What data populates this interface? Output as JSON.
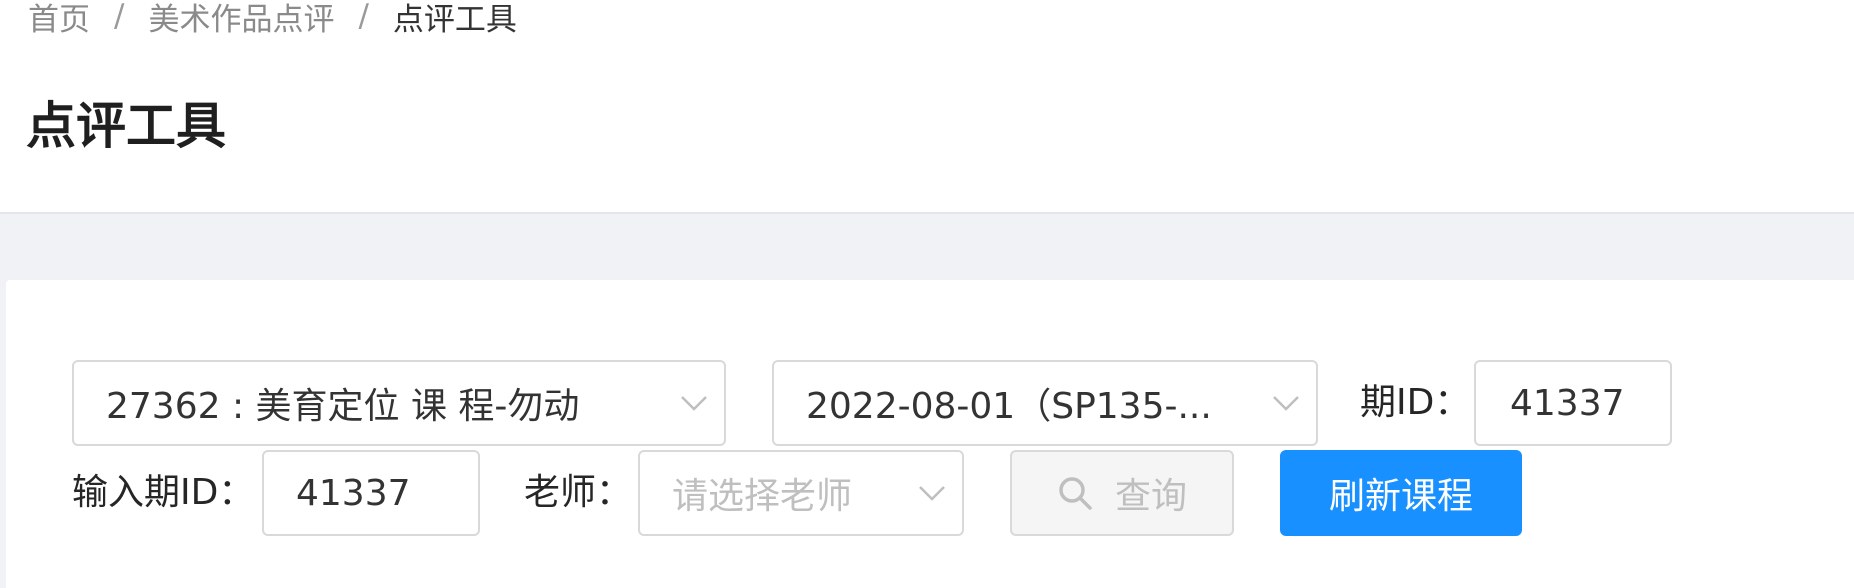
{
  "breadcrumb": {
    "items": [
      "首页",
      "美术作品点评",
      "点评工具"
    ],
    "separator": "/"
  },
  "page": {
    "title": "点评工具"
  },
  "filters": {
    "course_select": {
      "value": "27362 : 美育定位 课 程-勿动"
    },
    "date_select": {
      "value": "2022-08-01（SP135-..."
    },
    "period_id": {
      "label": "期ID：",
      "value": "41337"
    },
    "input_period_id": {
      "label": "输入期ID：",
      "value": "41337"
    },
    "teacher": {
      "label": "老师：",
      "placeholder": "请选择老师"
    },
    "search_button": {
      "label": "查询",
      "icon": "search-icon"
    },
    "refresh_button": {
      "label": "刷新课程"
    }
  },
  "colors": {
    "primary": "#1890ff",
    "background_gray": "#f0f2f5",
    "border": "#d9d9d9",
    "placeholder": "#bfbfbf"
  }
}
